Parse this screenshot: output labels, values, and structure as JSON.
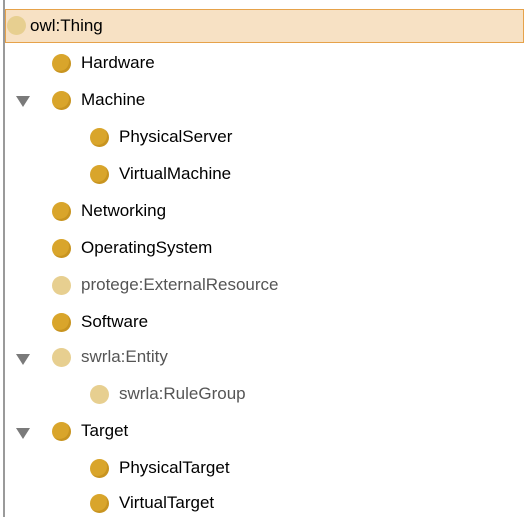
{
  "tree": {
    "root": {
      "label": "owl:Thing",
      "icon": "class-circle-icon",
      "status": "inferred"
    },
    "nodes": [
      {
        "label": "Hardware",
        "icon": "class-circle-icon",
        "status": "asserted"
      },
      {
        "label": "Machine",
        "icon": "class-circle-icon",
        "status": "asserted",
        "expanded": true
      },
      {
        "label": "PhysicalServer",
        "icon": "class-circle-icon",
        "status": "asserted"
      },
      {
        "label": "VirtualMachine",
        "icon": "class-circle-icon",
        "status": "asserted"
      },
      {
        "label": "Networking",
        "icon": "class-circle-icon",
        "status": "asserted"
      },
      {
        "label": "OperatingSystem",
        "icon": "class-circle-icon",
        "status": "asserted"
      },
      {
        "label": "protege:ExternalResource",
        "icon": "class-circle-icon",
        "status": "inferred"
      },
      {
        "label": "Software",
        "icon": "class-circle-icon",
        "status": "asserted"
      },
      {
        "label": "swrla:Entity",
        "icon": "class-circle-icon",
        "status": "inferred",
        "expanded": true
      },
      {
        "label": "swrla:RuleGroup",
        "icon": "class-circle-icon",
        "status": "inferred"
      },
      {
        "label": "Target",
        "icon": "class-circle-icon",
        "status": "asserted",
        "expanded": true
      },
      {
        "label": "PhysicalTarget",
        "icon": "class-circle-icon",
        "status": "asserted"
      },
      {
        "label": "VirtualTarget",
        "icon": "class-circle-icon",
        "status": "asserted"
      }
    ]
  },
  "colors": {
    "selection_background": "#f7e1c4",
    "selection_border": "#e6a24a",
    "class_icon": "#d9a52b",
    "class_icon_faded": "#e7cf90",
    "toggle_arrow": "#7a7a7a"
  }
}
